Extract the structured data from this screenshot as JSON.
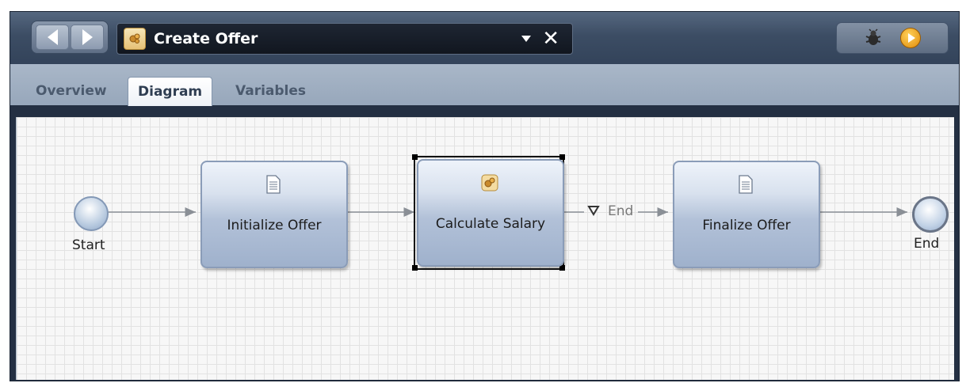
{
  "toolbar": {
    "title": "Create Offer",
    "back_icon": "triangle-left-icon",
    "forward_icon": "triangle-right-icon",
    "close_icon": "close-icon",
    "debug_icon": "bug-icon",
    "run_icon": "play-icon"
  },
  "tabs": [
    {
      "label": "Overview",
      "active": false
    },
    {
      "label": "Diagram",
      "active": true
    },
    {
      "label": "Variables",
      "active": false
    }
  ],
  "diagram": {
    "start_label": "Start",
    "end_label": "End",
    "tasks": [
      {
        "label": "Initialize Offer",
        "icon": "script-icon"
      },
      {
        "label": "Calculate Salary",
        "icon": "service-icon"
      },
      {
        "label": "Finalize Offer",
        "icon": "script-icon"
      }
    ],
    "intermediate_end_label": "End"
  },
  "colors": {
    "toolbar": "#3c4d64",
    "tabbar": "#a9b7c8",
    "task_fill": "#b2c1d8",
    "canvas": "#f7f7f7"
  }
}
